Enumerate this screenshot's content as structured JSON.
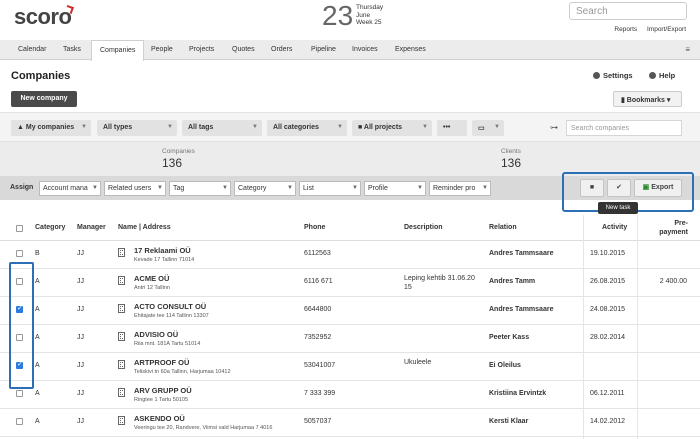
{
  "app": {
    "logo": "scoro"
  },
  "date": {
    "day": "23",
    "weekday": "Thursday",
    "month": "June",
    "week": "Week 25"
  },
  "top": {
    "search_placeholder": "Search",
    "reports": "Reports",
    "import_export": "Import/Export"
  },
  "tabs": [
    "Calendar",
    "Tasks",
    "Companies",
    "People",
    "Projects",
    "Quotes",
    "Orders",
    "Pipeline",
    "Invoices",
    "Expenses"
  ],
  "tabs_active": "Companies",
  "page": {
    "title": "Companies",
    "settings": "Settings",
    "help": "Help",
    "new_company": "New company",
    "bookmarks": "Bookmarks"
  },
  "filters": {
    "my_companies": "My companies",
    "all_types": "All types",
    "all_tags": "All tags",
    "all_categories": "All categories",
    "all_projects": "All projects",
    "more": "•••",
    "search_placeholder": "Search companies"
  },
  "stats": {
    "companies_label": "Companies",
    "companies_value": "136",
    "clients_label": "Clients",
    "clients_value": "136"
  },
  "assign": {
    "label": "Assign",
    "dropdowns": [
      "Account mana",
      "Related users",
      "Tag",
      "Category",
      "List",
      "Profile",
      "Reminder pro"
    ],
    "export": "Export",
    "tooltip": "New task"
  },
  "table": {
    "headers": {
      "category": "Category",
      "manager": "Manager",
      "name": "Name | Address",
      "phone": "Phone",
      "description": "Description",
      "relation": "Relation",
      "activity": "Activity",
      "prepayment": "Pre-\npayment"
    },
    "rows": [
      {
        "checked": false,
        "category": "B",
        "manager": "JJ",
        "name": "17 Reklaami OÜ",
        "address": "Kevade 17 Tallinn 71014",
        "phone": "6112563",
        "description": "",
        "relation": "Andres Tammsaare",
        "activity": "19.10.2015",
        "prepayment": ""
      },
      {
        "checked": false,
        "category": "A",
        "manager": "JJ",
        "name": "ACME OÜ",
        "address": "Antri 12 Tallinn",
        "phone": "6116 671",
        "description": "Leping kehtib 31.06.20 15",
        "relation": "Andres Tamm",
        "activity": "26.08.2015",
        "prepayment": "2 400.00"
      },
      {
        "checked": true,
        "category": "A",
        "manager": "JJ",
        "name": "ACTO CONSULT OÜ",
        "address": "Ehitajate tee 114 Tallinn 13307",
        "phone": "6644800",
        "description": "",
        "relation": "Andres Tammsaare",
        "activity": "24.08.2015",
        "prepayment": ""
      },
      {
        "checked": false,
        "category": "A",
        "manager": "JJ",
        "name": "ADVISIO OÜ",
        "address": "Riia mnt. 181A Tartu 51014",
        "phone": "7352952",
        "description": "",
        "relation": "Peeter Kass",
        "activity": "28.02.2014",
        "prepayment": ""
      },
      {
        "checked": true,
        "category": "A",
        "manager": "JJ",
        "name": "ARTPROOF OÜ",
        "address": "Teliskivi tn 60a Tallinn, Harjumaa 10412",
        "phone": "53041007",
        "description": "Ukuleele",
        "relation": "Ei Oleilus",
        "activity": "",
        "prepayment": ""
      },
      {
        "checked": false,
        "category": "A",
        "manager": "JJ",
        "name": "ARV GRUPP OÜ",
        "address": "Ringtee 1 Tartu 50105",
        "phone": "7 333 399",
        "description": "",
        "relation": "Kristiina Ervintzk",
        "activity": "06.12.2011",
        "prepayment": ""
      },
      {
        "checked": false,
        "category": "A",
        "manager": "JJ",
        "name": "ASKENDO OÜ",
        "address": "Veeringu tee 20, Randvere, Viimsi vald Harjumaa 7 4016",
        "phone": "5057037",
        "description": "",
        "relation": "Kersti Klaar",
        "activity": "14.02.2012",
        "prepayment": ""
      }
    ]
  },
  "colors": {
    "accent": "#2d6fb6",
    "logo_mark": "#d12a2a",
    "checkbox": "#2d7be0"
  }
}
